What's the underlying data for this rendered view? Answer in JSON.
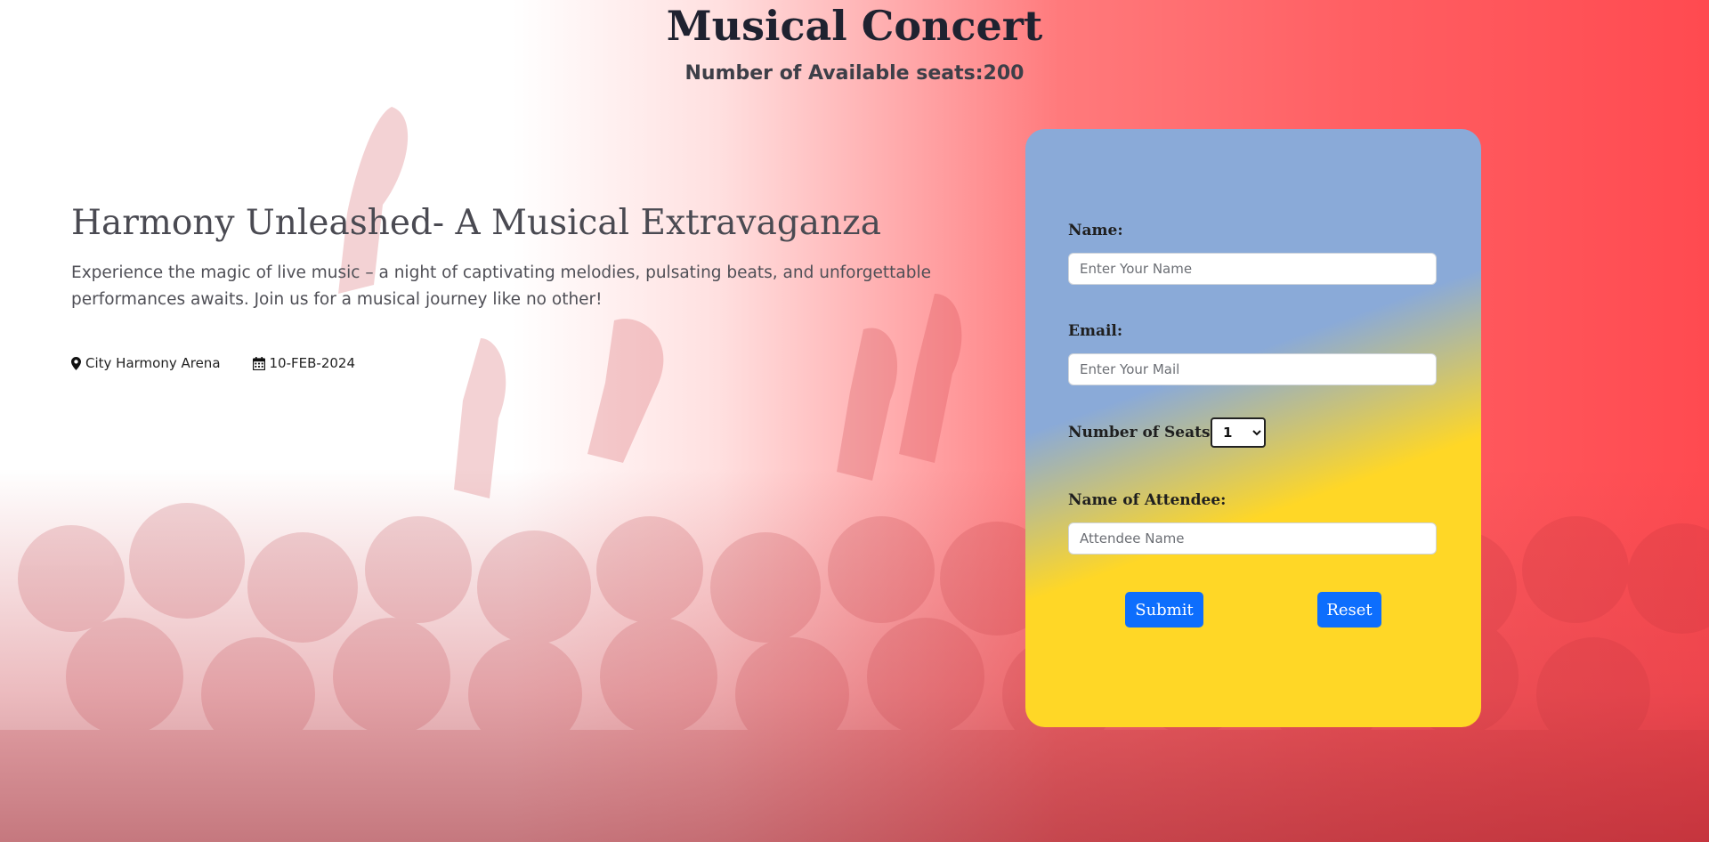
{
  "header": {
    "title": "Musical Concert",
    "seats_available": "Number of Available seats:200"
  },
  "event": {
    "title": "Harmony Unleashed- A Musical Extravaganza",
    "description": "Experience the magic of live music – a night of captivating melodies, pulsating beats, and unforgettable performances awaits. Join us for a musical journey like no other!",
    "venue": "City Harmony Arena",
    "venue_icon": "map-marker-icon",
    "date": "10-FEB-2024",
    "date_icon": "calendar-icon"
  },
  "form": {
    "name_label": "Name:",
    "name_placeholder": "Enter Your Name",
    "email_label": "Email:",
    "email_placeholder": "Enter Your Mail",
    "seats_label": "Number of Seats:",
    "seats_value": "1",
    "attendee_label": "Name of Attendee:",
    "attendee_placeholder": "Attendee Name",
    "submit_label": "Submit",
    "reset_label": "Reset"
  },
  "colors": {
    "accent_button": "#0d6efd",
    "card_blue": "#8aaad8",
    "card_yellow": "#ffd726",
    "background_red": "#ff5e62"
  }
}
